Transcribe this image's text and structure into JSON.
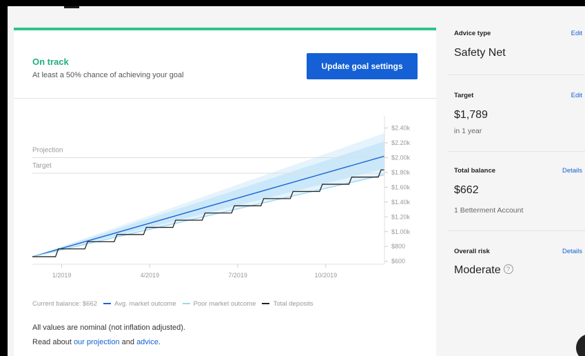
{
  "status": {
    "title": "On track",
    "description": "At least a 50% chance of achieving your goal",
    "update_button": "Update goal settings"
  },
  "sidebar": {
    "advice_type": {
      "label": "Advice type",
      "link": "Edit",
      "value": "Safety Net"
    },
    "target": {
      "label": "Target",
      "link": "Edit",
      "value": "$1,789",
      "sub": "in 1 year"
    },
    "total_balance": {
      "label": "Total balance",
      "link": "Details",
      "value": "$662",
      "sub": "1 Betterment Account"
    },
    "overall_risk": {
      "label": "Overall risk",
      "link": "Details",
      "value": "Moderate",
      "help_glyph": "?"
    }
  },
  "footer": {
    "nominal_note": "All values are nominal (not inflation adjusted).",
    "read_prefix": "Read about ",
    "projection_link": "our projection",
    "and": " and ",
    "advice_link": "advice",
    "suffix": "."
  },
  "chart_data": {
    "type": "area",
    "x_unit": "months since 12/2018",
    "x_ticks": [
      {
        "x": 1,
        "label": "1/2019"
      },
      {
        "x": 4,
        "label": "4/2019"
      },
      {
        "x": 7,
        "label": "7/2019"
      },
      {
        "x": 10,
        "label": "10/2019"
      }
    ],
    "y_ticks": [
      600,
      800,
      1000,
      1200,
      1400,
      1600,
      1800,
      2000,
      2200,
      2400
    ],
    "y_tick_labels": [
      "$600",
      "$800",
      "$1.00k",
      "$1.20k",
      "$1.40k",
      "$1.60k",
      "$1.80k",
      "$2.00k",
      "$2.20k",
      "$2.40k"
    ],
    "ylim": [
      560,
      2470
    ],
    "xlim": [
      0,
      12
    ],
    "reference_lines": [
      {
        "label": "Projection",
        "value": 2000
      },
      {
        "label": "Target",
        "value": 1789
      }
    ],
    "bands": [
      {
        "name": "outer",
        "color": "#e5f3fc",
        "start": 662,
        "end_low": 1760,
        "end_high": 2330
      },
      {
        "name": "inner",
        "color": "#cbe8fa",
        "start": 662,
        "end_low": 1850,
        "end_high": 2220
      }
    ],
    "series": [
      {
        "name": "Avg. market outcome",
        "color": "#1a63d6",
        "x": [
          0,
          12
        ],
        "values": [
          662,
          2020
        ]
      },
      {
        "name": "Poor market outcome",
        "color": "#9dd8f0",
        "x": [
          0,
          12
        ],
        "values": [
          662,
          1770
        ]
      },
      {
        "name": "Total deposits",
        "color": "#222222",
        "type": "step",
        "x": [
          0,
          1,
          2,
          3,
          4,
          5,
          6,
          7,
          8,
          9,
          10,
          11,
          12
        ],
        "values": [
          662,
          767,
          864,
          961,
          1058,
          1155,
          1252,
          1349,
          1446,
          1543,
          1640,
          1737,
          1834
        ]
      }
    ],
    "legend": {
      "current_balance": "Current balance: $662",
      "avg": "Avg. market outcome",
      "poor": "Poor market outcome",
      "deposits": "Total deposits"
    }
  }
}
